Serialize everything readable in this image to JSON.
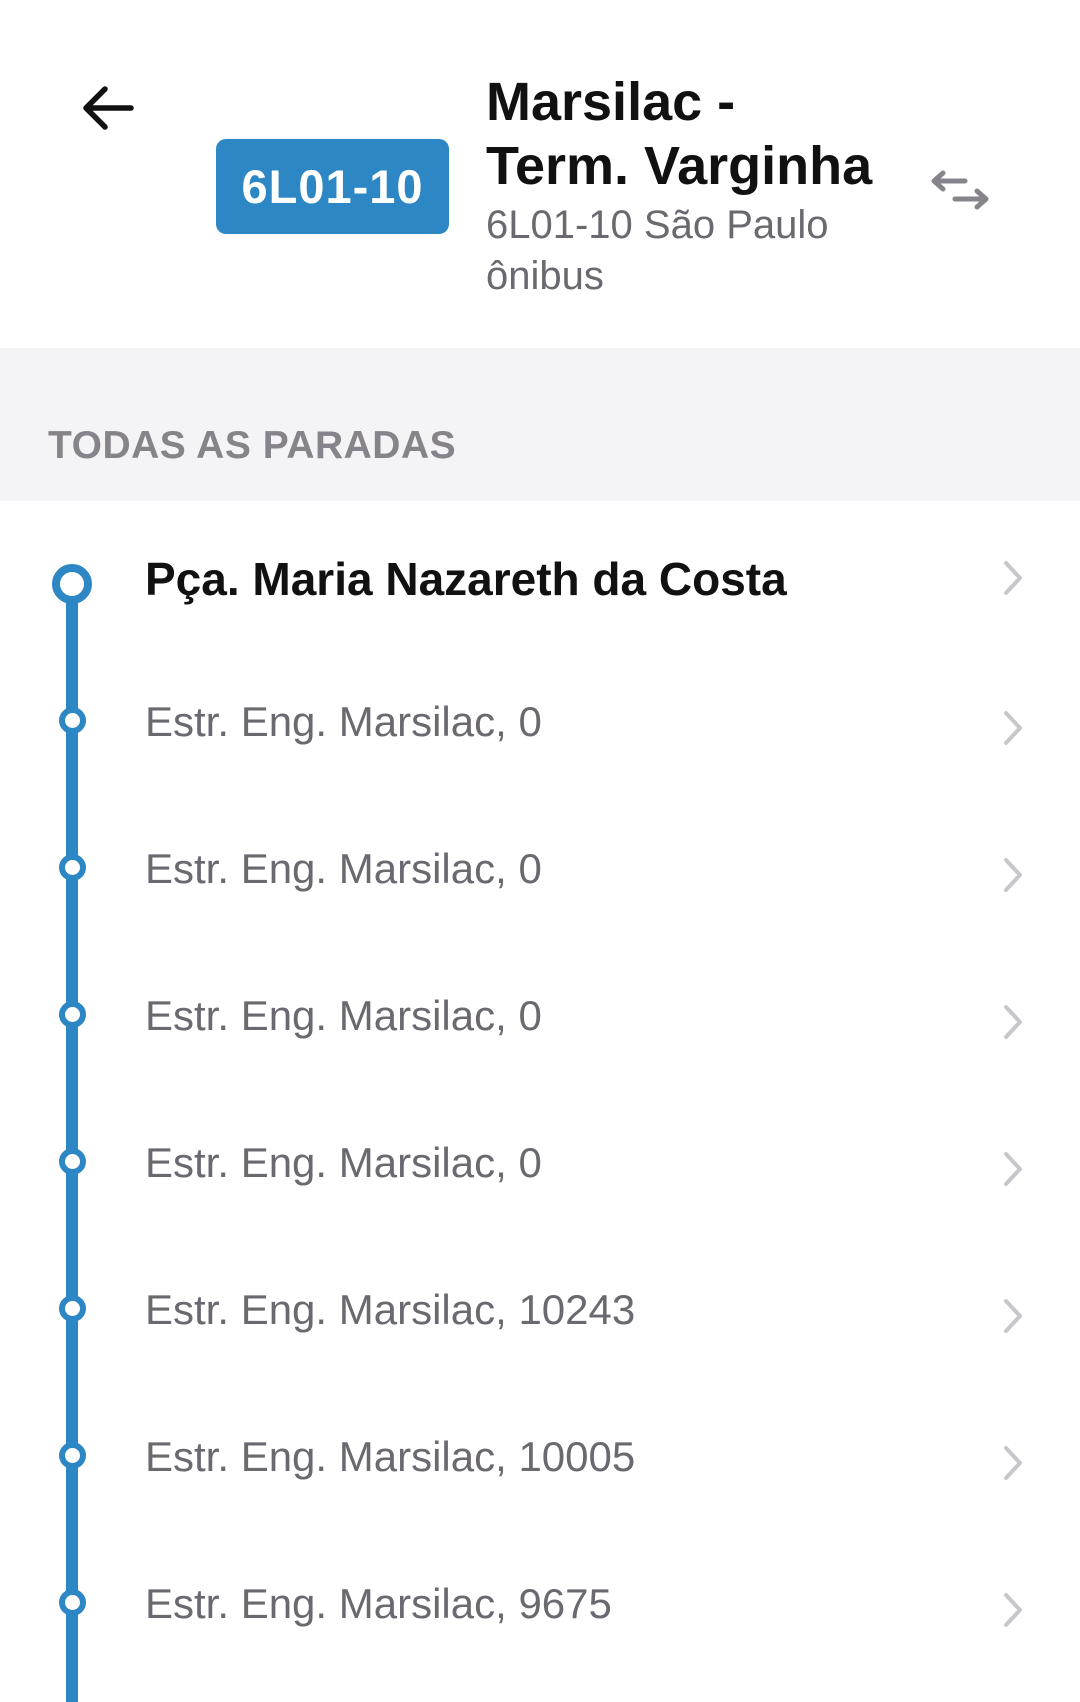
{
  "header": {
    "back_icon": "arrow-left-icon",
    "route_code": "6L01-10",
    "title_line1": "Marsilac -",
    "title_line2": "Term. Varginha",
    "subtitle_line1": "6L01-10 São Paulo",
    "subtitle_line2": "ônibus",
    "swap_icon": "swap-direction-icon",
    "accent_color": "#2c87c4"
  },
  "section": {
    "label": "TODAS AS PARADAS"
  },
  "stops": [
    {
      "name": "Pça. Maria Nazareth da Costa"
    },
    {
      "name": "Estr. Eng. Marsilac, 0"
    },
    {
      "name": "Estr. Eng. Marsilac, 0"
    },
    {
      "name": "Estr. Eng. Marsilac, 0"
    },
    {
      "name": "Estr. Eng. Marsilac, 0"
    },
    {
      "name": "Estr. Eng. Marsilac, 10243"
    },
    {
      "name": "Estr. Eng. Marsilac, 10005"
    },
    {
      "name": "Estr. Eng. Marsilac, 9675"
    }
  ]
}
